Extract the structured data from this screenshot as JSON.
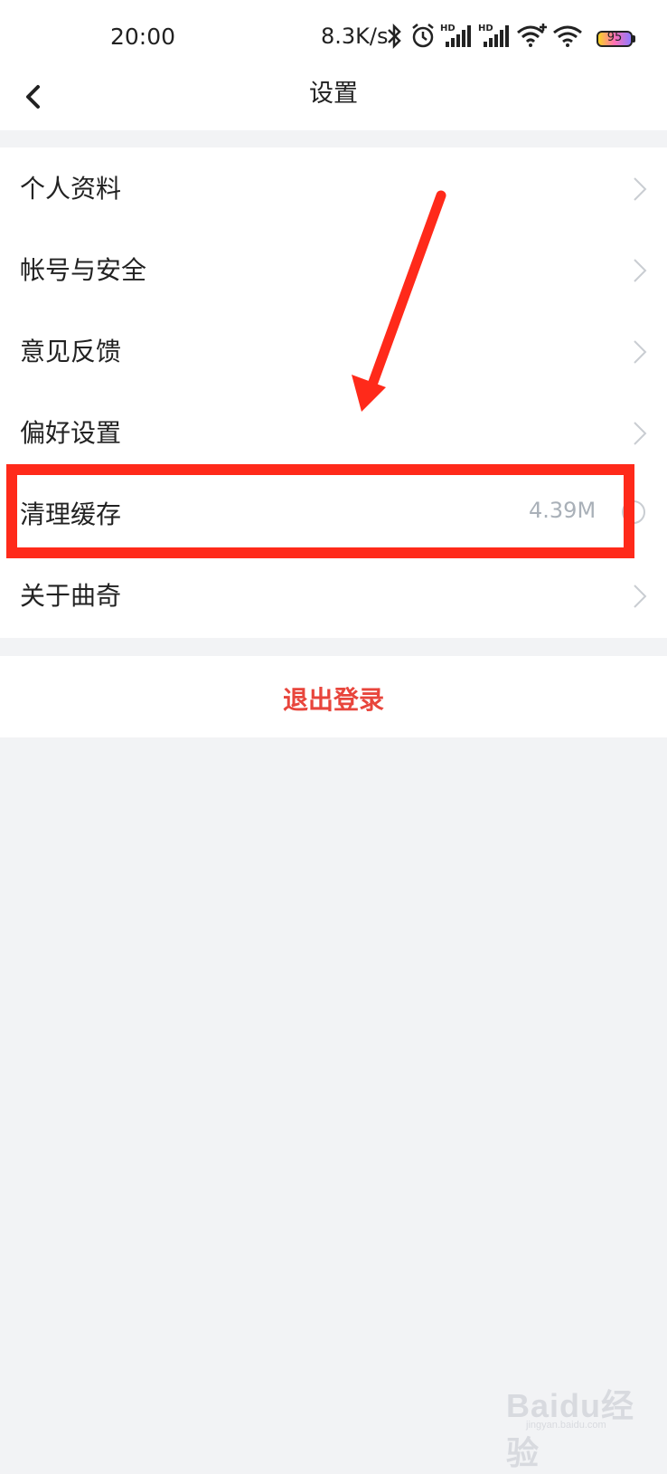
{
  "status_bar": {
    "time": "20:00",
    "network_speed": "8.3K/s",
    "battery_level": "95",
    "icons": [
      "bluetooth-icon",
      "alarm-icon",
      "hd-signal-icon",
      "hd-signal-icon",
      "wifi-plus-icon",
      "wifi-icon",
      "battery-icon"
    ]
  },
  "header": {
    "title": "设置",
    "back_icon": "chevron-left-icon"
  },
  "menu": {
    "items": [
      {
        "label": "个人资料",
        "icon": "chevron-right-icon"
      },
      {
        "label": "帐号与安全",
        "icon": "chevron-right-icon"
      },
      {
        "label": "意见反馈",
        "icon": "chevron-right-icon"
      },
      {
        "label": "偏好设置",
        "icon": "chevron-right-icon"
      },
      {
        "label": "清理缓存",
        "value": "4.39M",
        "icon": "circle-icon"
      },
      {
        "label": "关于曲奇",
        "icon": "chevron-right-icon"
      }
    ]
  },
  "logout": {
    "label": "退出登录"
  },
  "annotation": {
    "color": "#ff2a1a",
    "highlighted_item": "清理缓存"
  },
  "colors": {
    "accent": "#e8453c",
    "background": "#f2f3f5",
    "secondary_text": "#a9b0b8"
  },
  "watermark": {
    "brand": "Baidu经验",
    "url": "jingyan.baidu.com"
  }
}
